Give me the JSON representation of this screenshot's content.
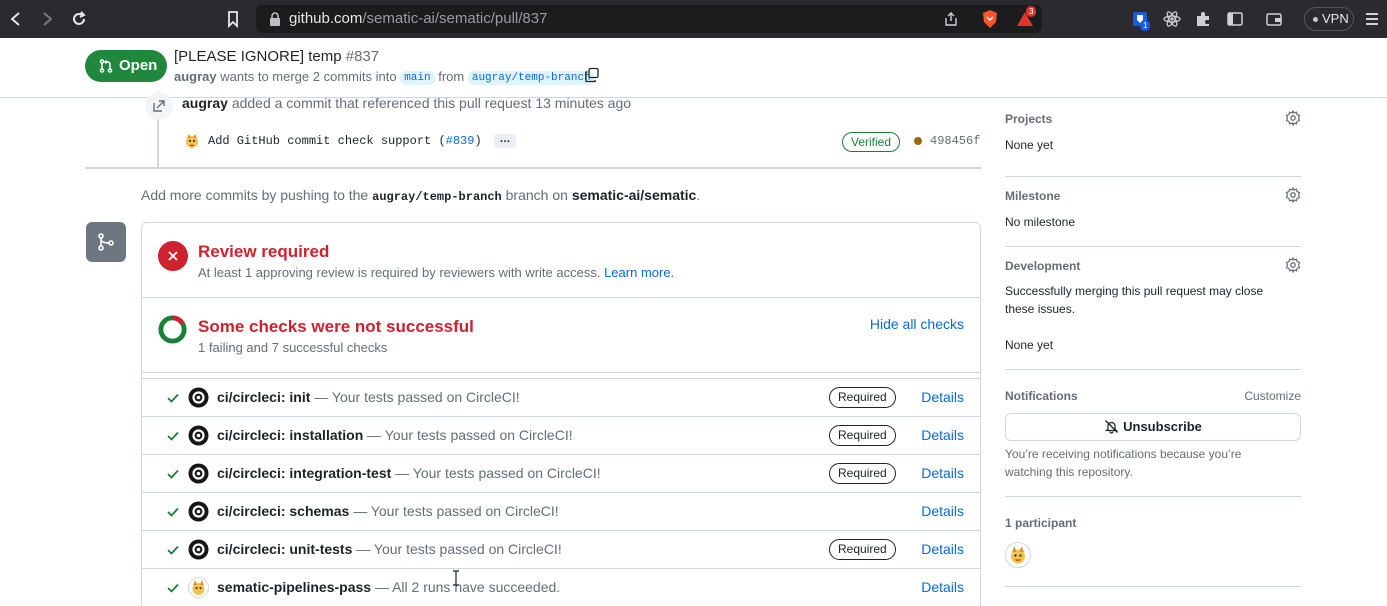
{
  "browser": {
    "url_host": "github.com",
    "url_path": "/sematic-ai/sematic/pull/837",
    "shields_badge": "3",
    "ext_badge": "1",
    "vpn_label": "VPN"
  },
  "pr": {
    "state": "Open",
    "title": "[PLEASE IGNORE] temp",
    "number": "#837",
    "author": "augray",
    "merge_phrase": "wants to merge 2 commits into",
    "base_branch": "main",
    "from_word": "from",
    "head_branch": "augray/temp-branch"
  },
  "timeline": {
    "actor": "augray",
    "event_text": "added a commit that referenced this pull request 13 minutes ago",
    "commit_message_prefix": "Add GitHub commit check support (",
    "commit_link": "#839",
    "commit_message_suffix": ")",
    "commit_more": "…",
    "verified_label": "Verified",
    "commit_sha": "498456f",
    "push_prefix": "Add more commits by pushing to the",
    "push_branch": "augray/temp-branch",
    "push_middle": "branch on",
    "push_repo": "sematic-ai/sematic",
    "push_suffix": "."
  },
  "merge_box": {
    "review_title": "Review required",
    "review_sub": "At least 1 approving review is required by reviewers with write access.",
    "learn_more": "Learn more.",
    "checks_title": "Some checks were not successful",
    "checks_sub": "1 failing and 7 successful checks",
    "hide_checks": "Hide all checks",
    "details_label": "Details",
    "required_label": "Required",
    "checks": [
      {
        "name": "ci/circleci: init",
        "desc": "— Your tests passed on CircleCI!",
        "required": true
      },
      {
        "name": "ci/circleci: installation",
        "desc": "— Your tests passed on CircleCI!",
        "required": true
      },
      {
        "name": "ci/circleci: integration-test",
        "desc": "— Your tests passed on CircleCI!",
        "required": true
      },
      {
        "name": "ci/circleci: schemas",
        "desc": "— Your tests passed on CircleCI!",
        "required": false
      },
      {
        "name": "ci/circleci: unit-tests",
        "desc": "— Your tests passed on CircleCI!",
        "required": true
      },
      {
        "name": "sematic-pipelines-pass",
        "desc": "— All 2 runs have succeeded.",
        "required": false
      }
    ]
  },
  "sidebar": {
    "projects_heading": "Projects",
    "projects_value": "None yet",
    "milestone_heading": "Milestone",
    "milestone_value": "No milestone",
    "development_heading": "Development",
    "development_note": "Successfully merging this pull request may close these issues.",
    "development_value": "None yet",
    "notifications_heading": "Notifications",
    "customize_label": "Customize",
    "unsubscribe_label": "Unsubscribe",
    "notifications_note": "You’re receiving notifications because you’re watching this repository.",
    "participants_heading": "1 participant"
  },
  "colors": {
    "open_green": "#1f883d",
    "danger_red": "#cf222e",
    "link_blue": "#0969da",
    "success_green": "#1a7f37"
  }
}
